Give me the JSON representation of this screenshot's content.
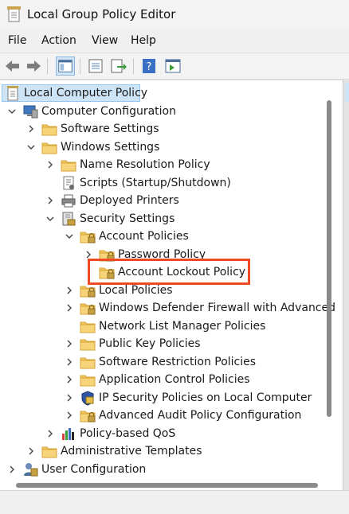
{
  "window": {
    "title": "Local Group Policy Editor"
  },
  "menu": [
    "File",
    "Action",
    "View",
    "Help"
  ],
  "toolbar": {
    "buttons": [
      "back-arrow-icon",
      "forward-arrow-icon",
      "show-hide-console-tree-icon",
      "properties-icon",
      "export-list-icon",
      "help-icon",
      "show-hide-action-pane-icon"
    ]
  },
  "tree": [
    {
      "label": "Local Computer Policy",
      "icon": "policy-document-icon",
      "selected": true
    },
    {
      "label": "Computer Configuration",
      "icon": "computer-icon",
      "expanded": true
    },
    {
      "label": "Software Settings",
      "icon": "folder-icon"
    },
    {
      "label": "Windows Settings",
      "icon": "folder-icon",
      "expanded": true
    },
    {
      "label": "Name Resolution Policy",
      "icon": "folder-icon"
    },
    {
      "label": "Scripts (Startup/Shutdown)",
      "icon": "scripts-icon"
    },
    {
      "label": "Deployed Printers",
      "icon": "printer-icon"
    },
    {
      "label": "Security Settings",
      "icon": "security-settings-icon",
      "expanded": true
    },
    {
      "label": "Account Policies",
      "icon": "locked-folder-icon",
      "expanded": true
    },
    {
      "label": "Password Policy",
      "icon": "locked-folder-icon"
    },
    {
      "label": "Account Lockout Policy",
      "icon": "locked-folder-icon",
      "highlighted": true
    },
    {
      "label": "Local Policies",
      "icon": "locked-folder-icon"
    },
    {
      "label": "Windows Defender Firewall with Advanced",
      "icon": "locked-folder-icon"
    },
    {
      "label": "Network List Manager Policies",
      "icon": "folder-icon"
    },
    {
      "label": "Public Key Policies",
      "icon": "folder-icon"
    },
    {
      "label": "Software Restriction Policies",
      "icon": "folder-icon"
    },
    {
      "label": "Application Control Policies",
      "icon": "folder-icon"
    },
    {
      "label": "IP Security Policies on Local Computer",
      "icon": "ip-security-icon"
    },
    {
      "label": "Advanced Audit Policy Configuration",
      "icon": "locked-folder-icon"
    },
    {
      "label": "Policy-based QoS",
      "icon": "bar-chart-icon"
    },
    {
      "label": "Administrative Templates",
      "icon": "folder-icon"
    },
    {
      "label": "User Configuration",
      "icon": "user-icon"
    }
  ],
  "colors": {
    "highlight_box": "#f04a24",
    "selection": "#cde4f7",
    "folder": "#f3c75e"
  }
}
